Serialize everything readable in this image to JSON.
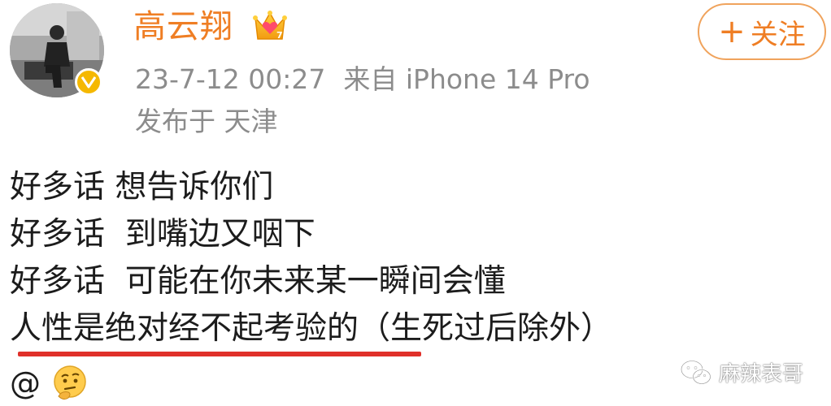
{
  "post": {
    "username": "高云翔",
    "follow_label": "关注",
    "follow_prefix": "+",
    "timestamp": "23-7-12 00:27",
    "source": "来自 iPhone 14 Pro",
    "location": "发布于 天津",
    "lines": [
      "好多话 想告诉你们",
      "好多话  到嘴边又咽下",
      "好多话  可能在你未来某一瞬间会懂"
    ],
    "last_line_underlined": "人性是绝对经不起考验的",
    "last_line_rest": "（生死过后除外）",
    "mention_symbol": "@"
  },
  "watermark": {
    "text": "麻辣表哥"
  },
  "colors": {
    "username": "#ef7e24",
    "follow_border": "#f0a35c",
    "meta_text": "#8c8c8c",
    "body_text": "#1c1c1c",
    "underline": "#e0302a",
    "verified_badge": "#f5b800"
  },
  "icons": {
    "verified": "verified-v-badge-icon",
    "crown": "vip-crown-icon",
    "emoji": "thinking-face-emoji-icon",
    "watermark": "wechat-logo-icon"
  }
}
